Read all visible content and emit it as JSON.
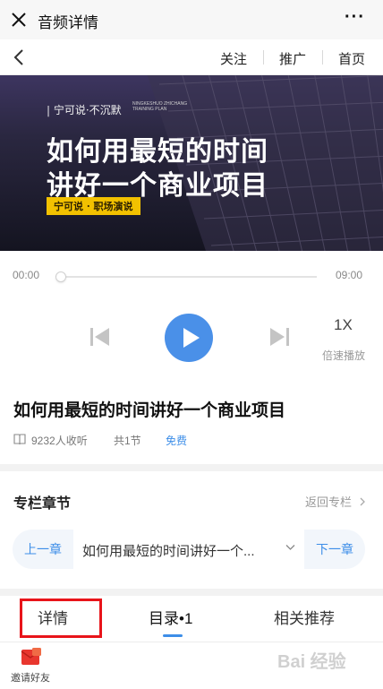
{
  "window": {
    "title": "音频详情",
    "more_label": "···"
  },
  "nav": {
    "links": [
      "关注",
      "推广",
      "首页"
    ]
  },
  "cover": {
    "brand": "| 宁可说·不沉默",
    "brand_en": "NINGKESHUO ZHICHANG TRAINING PLAN",
    "line1": "如何用最短的时间",
    "line2": "讲好一个商业项目",
    "badge": "宁可说 · 职场演说"
  },
  "player": {
    "current_time": "00:00",
    "total_time": "09:00",
    "progress": 0,
    "speed_value": "1X",
    "speed_label": "倍速播放"
  },
  "audio": {
    "title": "如何用最短的时间讲好一个商业项目",
    "listeners": "9232人收听",
    "sections": "共1节",
    "price": "免费"
  },
  "column": {
    "title": "专栏章节",
    "return_label": "返回专栏",
    "prev_label": "上一章",
    "current_chapter": "如何用最短的时间讲好一个...",
    "next_label": "下一章"
  },
  "tabs": [
    {
      "label": "详情"
    },
    {
      "label": "目录•1"
    },
    {
      "label": "相关推荐"
    }
  ],
  "footer": {
    "invite_label": "邀请好友",
    "watermark": "Bai 经验"
  },
  "colors": {
    "accent": "#3d8ee8",
    "play_button": "#4a90e8",
    "highlight": "#e8141a",
    "badge": "#f2c100"
  }
}
